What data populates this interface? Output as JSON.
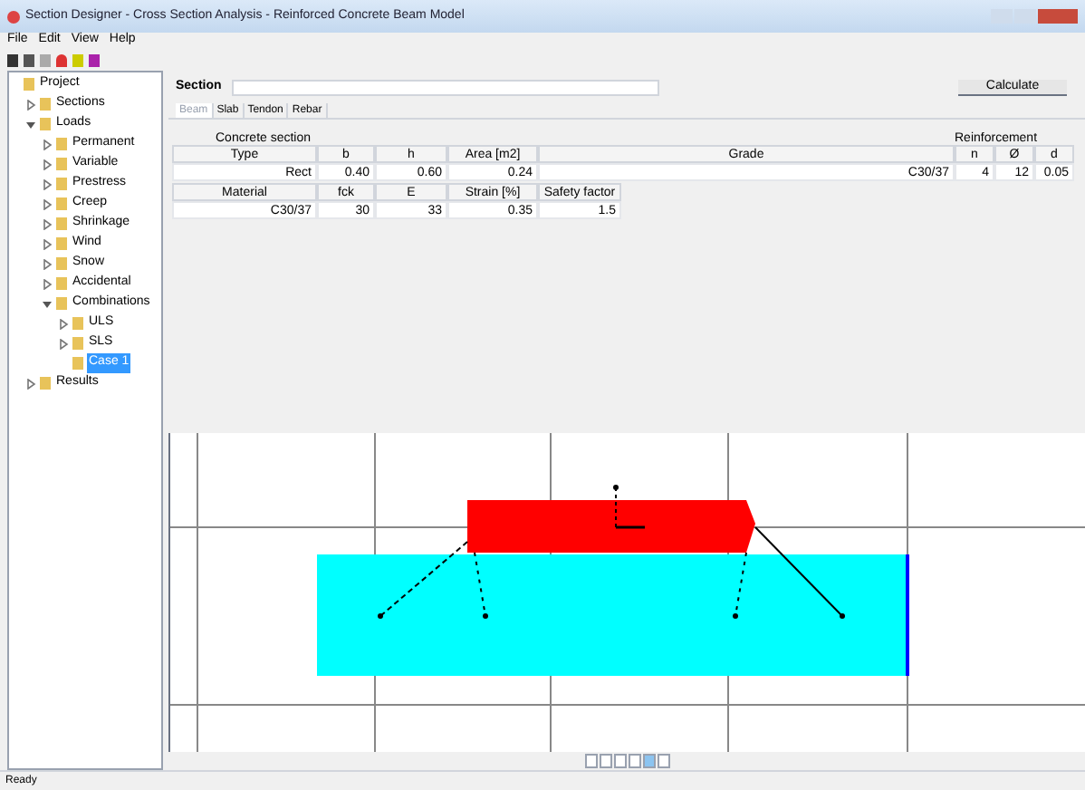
{
  "window": {
    "title": "Section Designer - Cross Section Analysis - Reinforced Concrete Beam Model"
  },
  "menu": [
    "File",
    "Edit",
    "View",
    "Help"
  ],
  "tree": {
    "label": "Project",
    "children": [
      {
        "label": "Sections",
        "expanded": false,
        "selected": false
      },
      {
        "label": "Loads",
        "expanded": true,
        "selected": false,
        "children": [
          {
            "label": "Permanent",
            "expanded": false,
            "selected": false
          },
          {
            "label": "Variable",
            "expanded": false,
            "selected": false
          },
          {
            "label": "Prestress",
            "expanded": false,
            "selected": false
          },
          {
            "label": "Creep",
            "expanded": false,
            "selected": false
          },
          {
            "label": "Shrinkage",
            "expanded": false,
            "selected": false
          },
          {
            "label": "Wind",
            "expanded": false,
            "selected": false
          },
          {
            "label": "Snow",
            "expanded": false,
            "selected": false
          },
          {
            "label": "Accidental",
            "expanded": false,
            "selected": false
          },
          {
            "label": "Combinations",
            "expanded": true,
            "selected": false,
            "children": [
              {
                "label": "ULS",
                "expanded": false,
                "selected": false
              },
              {
                "label": "SLS",
                "expanded": false,
                "selected": false
              },
              {
                "label": "Case 1",
                "selected": true
              }
            ]
          }
        ]
      },
      {
        "label": "Results",
        "expanded": false,
        "selected": false
      }
    ]
  },
  "section_field": {
    "label": "Section"
  },
  "run_button": "Calculate",
  "tabs": [
    {
      "label": "Beam",
      "selected": true
    },
    {
      "label": "Slab",
      "selected": false
    },
    {
      "label": "Tendon",
      "selected": false
    },
    {
      "label": "Rebar",
      "selected": false
    }
  ],
  "table1": {
    "group": "Concrete section",
    "columns": [
      "Type",
      "b",
      "h",
      "Area [m2]",
      "Grade"
    ],
    "row": [
      "Rect",
      "0.40",
      "0.60",
      "0.24",
      "C30/37"
    ],
    "side_group": "Reinforcement",
    "side_columns": [
      "n",
      "Ø",
      "d"
    ],
    "side_row": [
      "4",
      "12",
      "0.05"
    ]
  },
  "table2": {
    "columns": [
      "Material",
      "fck",
      "E",
      "Strain [%]",
      "Safety factor"
    ],
    "row": [
      "C30/37",
      "30",
      "33",
      "0.35",
      "1.5"
    ]
  },
  "status": "Ready"
}
